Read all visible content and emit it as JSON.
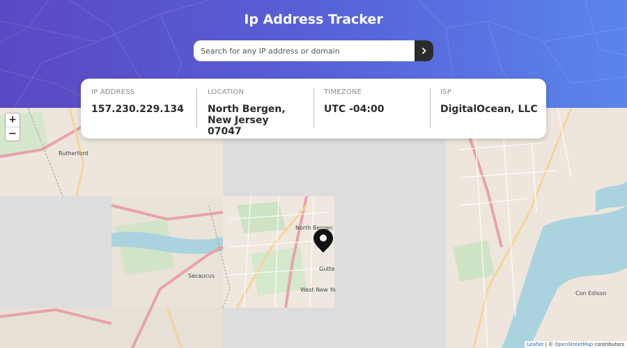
{
  "header": {
    "title": "Ip Address Tracker",
    "gradient": [
      "#5a49c2",
      "#5a85ec"
    ]
  },
  "search": {
    "placeholder": "Search for any IP address or domain",
    "value": "",
    "submit_icon": "chevron-right-icon"
  },
  "info": {
    "ip": {
      "label": "IP ADDRESS",
      "value": "157.230.229.134"
    },
    "location": {
      "label": "LOCATION",
      "value": "North Bergen, New Jersey 07047"
    },
    "timezone": {
      "label": "TIMEZONE",
      "value": "UTC -04:00"
    },
    "isp": {
      "label": "ISP",
      "value": "DigitalOcean, LLC"
    }
  },
  "map": {
    "zoom_in": "+",
    "zoom_out": "−",
    "marker_icon": "location-pin-icon",
    "places": {
      "rutherford": "Rutherford",
      "north_bergen": "North Bergen",
      "guttenberg": "Gutte",
      "secaucus": "Secaucus",
      "west_new_york": "West New Yo",
      "con_edison": "Con Edison"
    },
    "attribution": {
      "leaflet": "Leaflet",
      "separator": " | © ",
      "osm": "OpenStreetMap",
      "suffix": " contributors"
    }
  }
}
